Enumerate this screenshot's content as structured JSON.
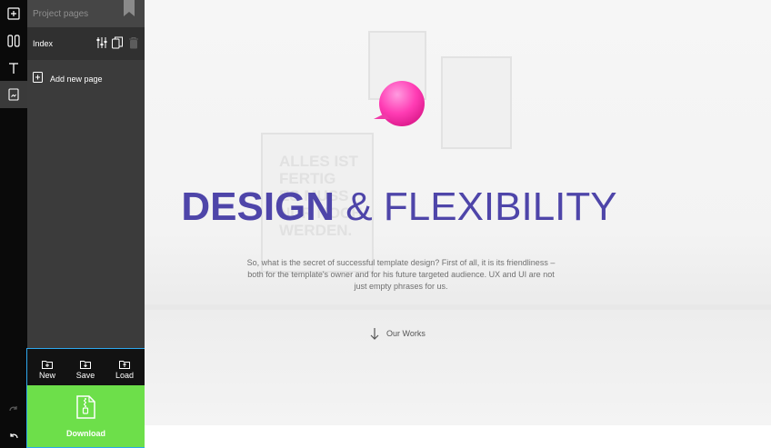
{
  "sidebar": {
    "title": "Project pages",
    "pages": [
      {
        "name": "Index"
      }
    ],
    "add_page_label": "Add new page"
  },
  "actions": {
    "new_label": "New",
    "save_label": "Save",
    "load_label": "Load",
    "download_label": "Download"
  },
  "hero": {
    "headline_bold": "DESIGN",
    "headline_rest": "& FLEXIBILITY",
    "description": "So, what is the secret of successful template design? First of all, it is its friendliness – both for the template's owner and for his future targeted audience. UX and UI are not just empty phrases for us.",
    "link_label": "Our Works",
    "background_poster_text": "ALLES IST\nFERTIG\nES MUSS\nNUR NOCH\nWERDEN."
  },
  "toolbar": {
    "tools": [
      "add-block-icon",
      "layout-columns-icon",
      "text-tool-icon",
      "page-icon"
    ],
    "active_tool": "page-icon",
    "history": [
      "redo-icon",
      "undo-icon"
    ]
  },
  "colors": {
    "accent": "#4e45a9",
    "download_green": "#6ddf4a",
    "selection_border": "#2ea8ee",
    "bubble_pink": "#ff3cb4"
  }
}
